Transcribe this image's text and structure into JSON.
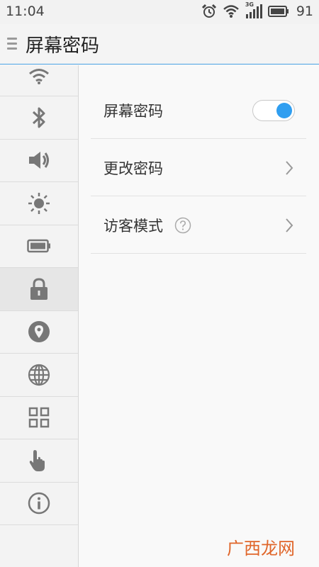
{
  "status_bar": {
    "time": "11:04",
    "network_label": "3G",
    "battery_percent": "91",
    "icons": [
      "alarm-icon",
      "wifi-icon",
      "cellular-signal-icon",
      "battery-icon"
    ]
  },
  "header": {
    "title": "屏幕密码",
    "menu_icon": "menu-icon"
  },
  "sidebar": {
    "items": [
      {
        "icon": "wifi-icon",
        "active": false
      },
      {
        "icon": "bluetooth-icon",
        "active": false
      },
      {
        "icon": "volume-icon",
        "active": false
      },
      {
        "icon": "brightness-icon",
        "active": false
      },
      {
        "icon": "battery-icon",
        "active": false
      },
      {
        "icon": "lock-icon",
        "active": true
      },
      {
        "icon": "location-icon",
        "active": false
      },
      {
        "icon": "globe-icon",
        "active": false
      },
      {
        "icon": "apps-grid-icon",
        "active": false
      },
      {
        "icon": "hand-pointer-icon",
        "active": false
      },
      {
        "icon": "info-icon",
        "active": false
      }
    ]
  },
  "settings": {
    "screen_password": {
      "label": "屏幕密码",
      "enabled": true
    },
    "change_password": {
      "label": "更改密码"
    },
    "guest_mode": {
      "label": "访客模式"
    }
  },
  "colors": {
    "accent": "#2f9ef0",
    "header_divider": "#4aa2e4",
    "watermark": "#e0662a"
  },
  "watermark": {
    "text": "广西龙网"
  }
}
